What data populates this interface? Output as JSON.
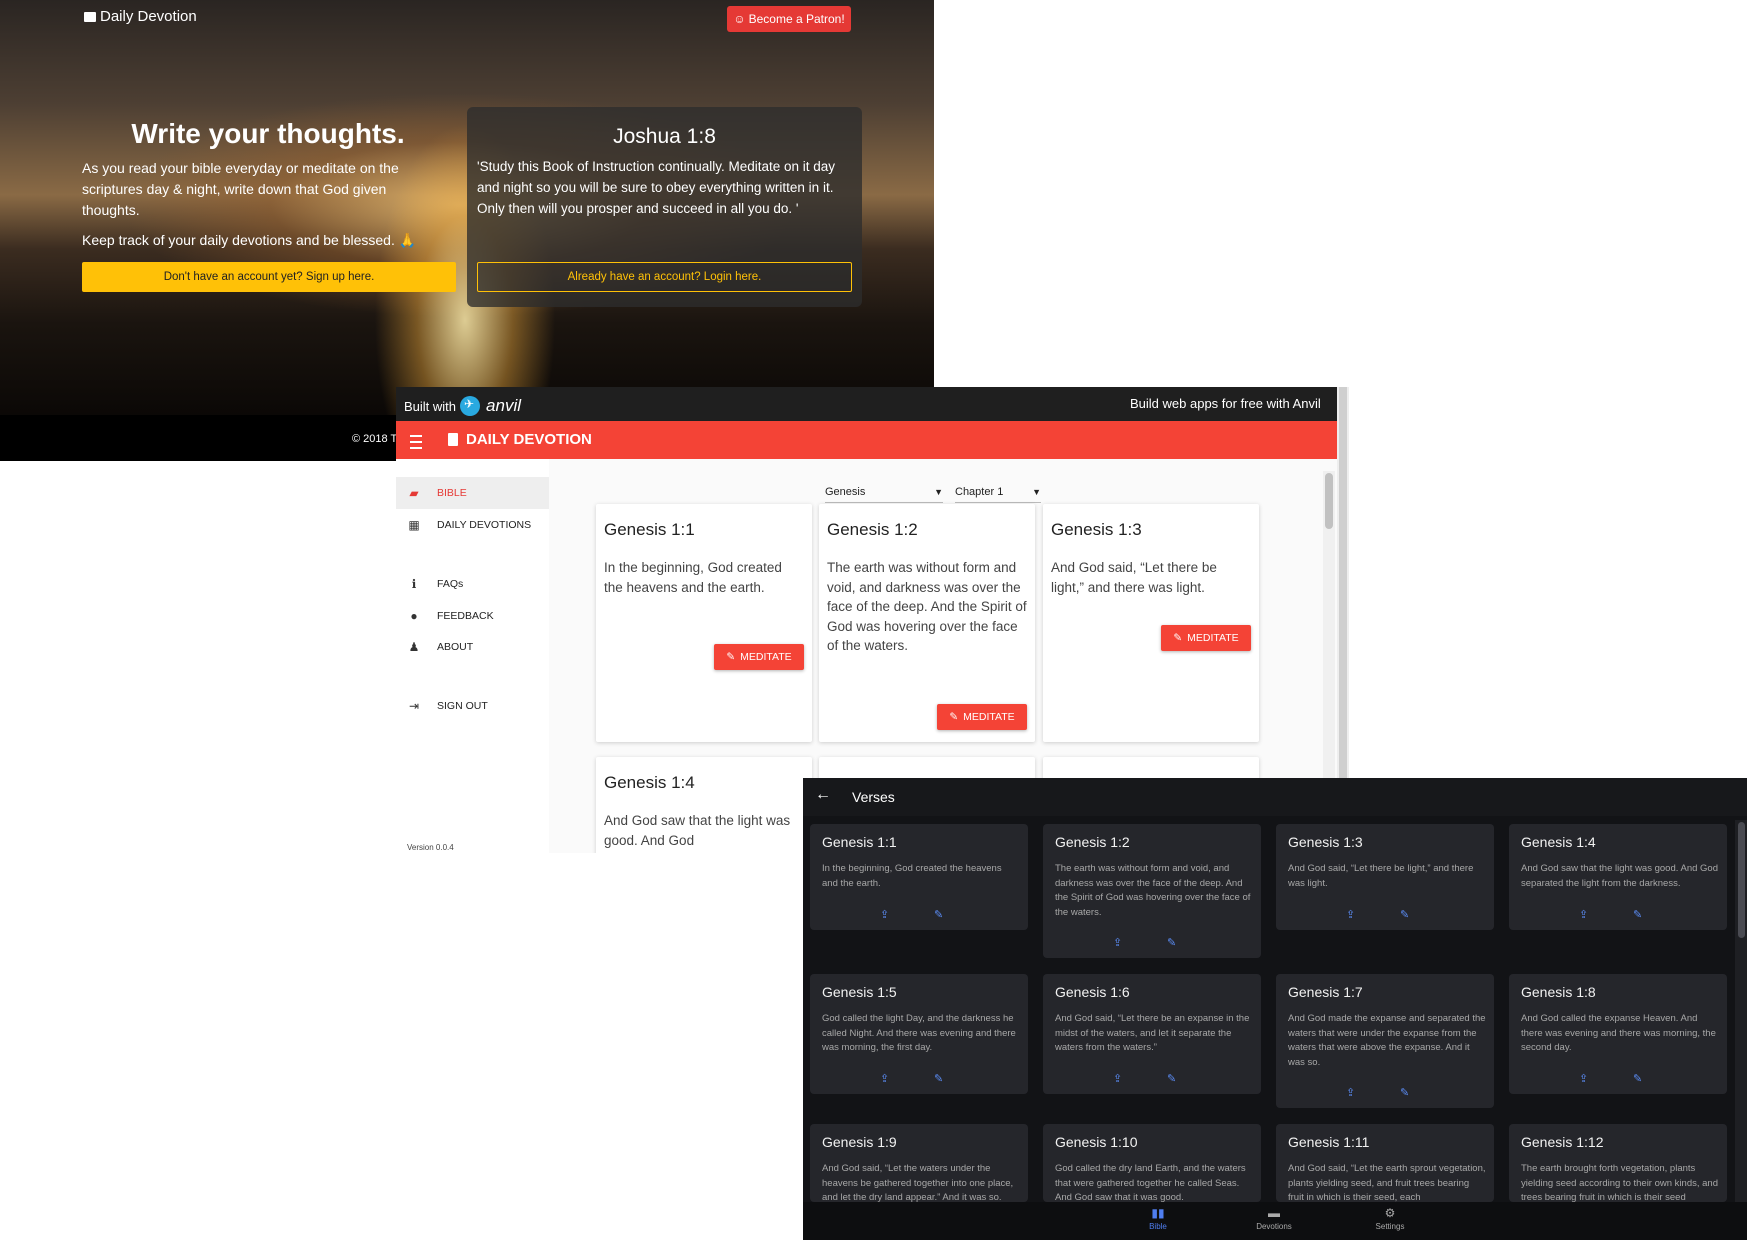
{
  "landing": {
    "brand": "Daily Devotion",
    "patron_button": "Become a Patron!",
    "headline": "Write your thoughts.",
    "description": "As you read your bible everyday or meditate on the scriptures day & night, write down that God given thoughts.",
    "keep_track": "Keep track of your daily devotions and be blessed. 🙏",
    "signup_button": "Don't have an account yet? Sign up here.",
    "verse_reference": "Joshua 1:8",
    "verse_text": "'Study this Book of Instruction continually. Meditate on it day and night so you will be sure to obey everything written in it. Only then will you prosper and succeed in all you do. '",
    "login_button": "Already have an account? Login here.",
    "copyright": "© 2018 T"
  },
  "anvil": {
    "built_with": "Built with",
    "anvil_word": "anvil",
    "build_free": "Build web apps for free with Anvil",
    "app_title": "DAILY DEVOTION",
    "nav": [
      {
        "label": "BIBLE",
        "icon": "book-icon"
      },
      {
        "label": "DAILY DEVOTIONS",
        "icon": "calendar-icon"
      },
      {
        "label": "FAQs",
        "icon": "info-icon"
      },
      {
        "label": "FEEDBACK",
        "icon": "comments-icon"
      },
      {
        "label": "ABOUT",
        "icon": "users-icon"
      },
      {
        "label": "SIGN OUT",
        "icon": "sign-out-icon"
      }
    ],
    "version": "Version 0.0.4",
    "book_select": "Genesis",
    "chapter_select": "Chapter 1",
    "meditate_label": "MEDITATE",
    "cards": [
      {
        "title": "Genesis 1:1",
        "text": "In the beginning, God created the heavens and the earth."
      },
      {
        "title": "Genesis 1:2",
        "text": "The earth was without form and void, and darkness was over the face of the deep. And the Spirit of God was hovering over the face of the waters."
      },
      {
        "title": "Genesis 1:3",
        "text": "And God said, “Let there be light,” and there was light."
      },
      {
        "title": "Genesis 1:4",
        "text": "And God saw that the light was good. And God"
      }
    ]
  },
  "verses": {
    "title": "Verses",
    "cards": [
      {
        "title": "Genesis 1:1",
        "text": "In the beginning, God created the heavens and the earth."
      },
      {
        "title": "Genesis 1:2",
        "text": "The earth was without form and void, and darkness was over the face of the deep. And the Spirit of God was hovering over the face of the waters."
      },
      {
        "title": "Genesis 1:3",
        "text": "And God said, “Let there be light,” and there was light."
      },
      {
        "title": "Genesis 1:4",
        "text": "And God saw that the light was good. And God separated the light from the darkness."
      },
      {
        "title": "Genesis 1:5",
        "text": "God called the light Day, and the darkness he called Night. And there was evening and there was morning, the first day."
      },
      {
        "title": "Genesis 1:6",
        "text": "And God said, “Let there be an expanse in the midst of the waters, and let it separate the waters from the waters.”"
      },
      {
        "title": "Genesis 1:7",
        "text": "And God made the expanse and separated the waters that were under the expanse from the waters that were above the expanse. And it was so."
      },
      {
        "title": "Genesis 1:8",
        "text": "And God called the expanse Heaven. And there was evening and there was morning, the second day."
      },
      {
        "title": "Genesis 1:9",
        "text": "And God said, “Let the waters under the heavens be gathered together into one place, and let the dry land appear.” And it was so."
      },
      {
        "title": "Genesis 1:10",
        "text": "God called the dry land Earth, and the waters that were gathered together he called Seas. And God saw that it was good."
      },
      {
        "title": "Genesis 1:11",
        "text": "And God said, “Let the earth sprout vegetation, plants yielding seed, and fruit trees bearing fruit in which is their seed, each"
      },
      {
        "title": "Genesis 1:12",
        "text": "The earth brought forth vegetation, plants yielding seed according to their own kinds, and trees bearing fruit in which is their seed"
      }
    ],
    "bottom_nav": [
      {
        "label": "Bible",
        "icon": "book-open-icon",
        "active": true
      },
      {
        "label": "Devotions",
        "icon": "bookmark-icon",
        "active": false
      },
      {
        "label": "Settings",
        "icon": "gear-icon",
        "active": false
      }
    ]
  }
}
